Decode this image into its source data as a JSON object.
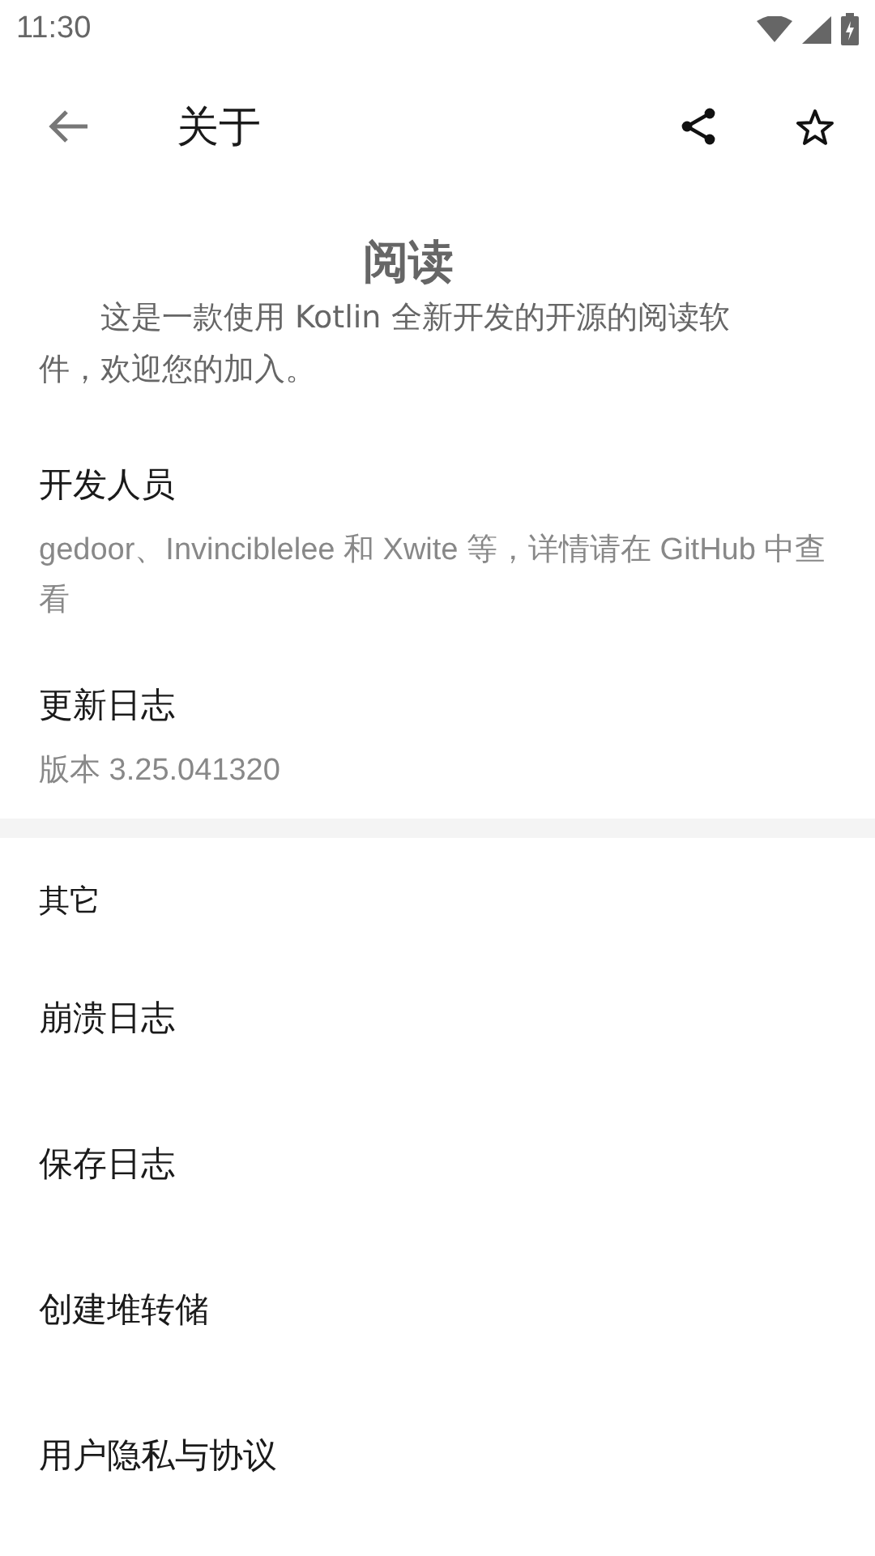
{
  "status_bar": {
    "time": "11:30"
  },
  "toolbar": {
    "title": "关于"
  },
  "app": {
    "name": "阅读",
    "description": "这是一款使用 Kotlin 全新开发的开源的阅读软件，欢迎您的加入。"
  },
  "info_items": [
    {
      "title": "开发人员",
      "summary": "gedoor、Invinciblelee 和 Xwite 等，详情请在 GitHub 中查看"
    },
    {
      "title": "更新日志",
      "summary": "版本 3.25.041320"
    }
  ],
  "other_section": {
    "header": "其它",
    "items": [
      "崩溃日志",
      "保存日志",
      "创建堆转储",
      "用户隐私与协议"
    ]
  }
}
